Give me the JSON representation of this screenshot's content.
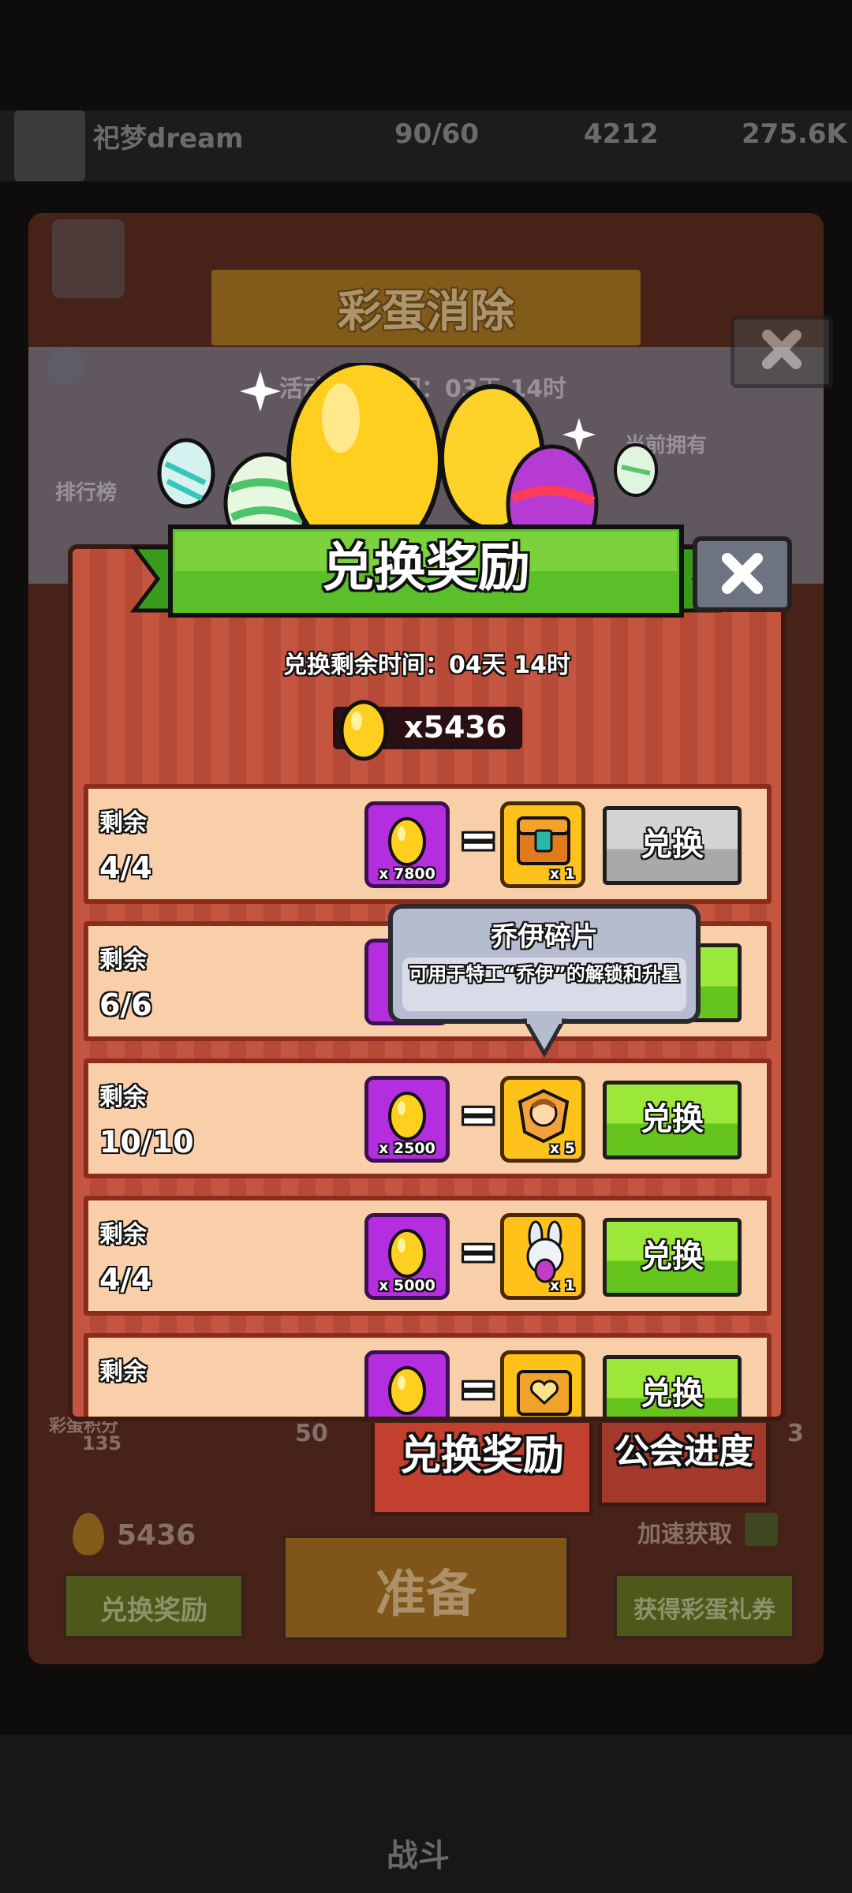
{
  "background": {
    "player_name": "祀梦dream",
    "stamina": "90/60",
    "gems": "4212",
    "coins": "275.6K",
    "event_title": "彩蛋消除",
    "event_time": "活动剩余时间：03天 14时",
    "leaderboard": "排行榜",
    "current_owned": "当前拥有",
    "egg_count": "5436",
    "exchange_btn": "兑换奖励",
    "ready_btn": "准备",
    "get_coupon_btn": "获得彩蛋礼券",
    "speedup_label": "加速获取",
    "left_stat_label": "彩蛋积分",
    "left_stat_value": "135",
    "mid_stat_value": "50",
    "right_stat_value": "3",
    "bottom_nav_label": "战斗"
  },
  "dialog": {
    "title": "兑换奖励",
    "time_remaining": "兑换剩余时间：04天 14时",
    "egg_balance": "x5436",
    "rows": [
      {
        "label": "剩余",
        "count": "4/4",
        "cost": "x 7800",
        "reward_qty": "x 1",
        "reward_icon": "treasure-chest-icon",
        "button": "兑换",
        "enabled": false
      },
      {
        "label": "剩余",
        "count": "6/6",
        "cost": "",
        "reward_qty": "",
        "reward_icon": "hidden",
        "button": "",
        "enabled": true
      },
      {
        "label": "剩余",
        "count": "10/10",
        "cost": "x 2500",
        "reward_qty": "x 5",
        "reward_icon": "joey-shard-icon",
        "button": "兑换",
        "enabled": true
      },
      {
        "label": "剩余",
        "count": "4/4",
        "cost": "x 5000",
        "reward_qty": "x 1",
        "reward_icon": "bunny-avatar-icon",
        "button": "兑换",
        "enabled": true
      },
      {
        "label": "剩余",
        "count": "",
        "cost": "",
        "reward_qty": "",
        "reward_icon": "heart-chest-icon",
        "button": "兑换",
        "enabled": true
      }
    ]
  },
  "tooltip": {
    "title": "乔伊碎片",
    "description": "可用于特工“乔伊”的解锁和升星"
  },
  "tabs": {
    "active": "兑换奖励",
    "inactive": "公会进度"
  }
}
